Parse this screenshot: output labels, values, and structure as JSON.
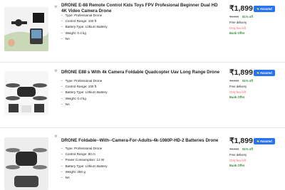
{
  "products": [
    {
      "title": "DRONE E-88 Remote Control Kids Toys FPV Profesional Beginner Dual HD 4K Video Camera Drone",
      "specs": [
        "Type: Professional Drone",
        "Control Range: 100 ft",
        "Battery Type: Lithium Battery",
        "Weight: 0.4 kg",
        "NA"
      ],
      "price": "₹1,899",
      "mrp": "₹9,998",
      "discount": "81% off",
      "delivery": "Free delivery",
      "stock": "Only few left",
      "offer": "Bank Offer",
      "assured": "Assured"
    },
    {
      "title": "DRONE E88 s With 4k Camera Foldable Quadcopter Uav Long Range Drone",
      "specs": [
        "Type: Professional Drone",
        "Control Range: 100 ft",
        "Battery Type: Lithium Battery",
        "Weight: 0.4 kg",
        "NA"
      ],
      "price": "₹1,899",
      "mrp": "₹9,998",
      "discount": "81% off",
      "delivery": "Free delivery",
      "stock": "Only few left",
      "offer": "Bank Offer",
      "assured": "Assured"
    },
    {
      "title": "DRONE Foldable--With--Camera-For-Adults-4k-1080P-HD-2 Batteries Drone",
      "specs": [
        "Type: Professional Drone",
        "Control Range: 80 m",
        "Power Consumption: 12 W",
        "Battery Type: Lithium Battery",
        "Weight: 250 g",
        "NA"
      ],
      "price": "₹1,899",
      "mrp": "₹9,998",
      "discount": "81% off",
      "delivery": "Free delivery",
      "stock": "Only few left",
      "offer": "Bank Offer",
      "assured": "Assured"
    }
  ],
  "colors": {
    "assured_badge": "#2874f0",
    "discount": "#388e3c",
    "stock_warning": "#ff6161"
  }
}
